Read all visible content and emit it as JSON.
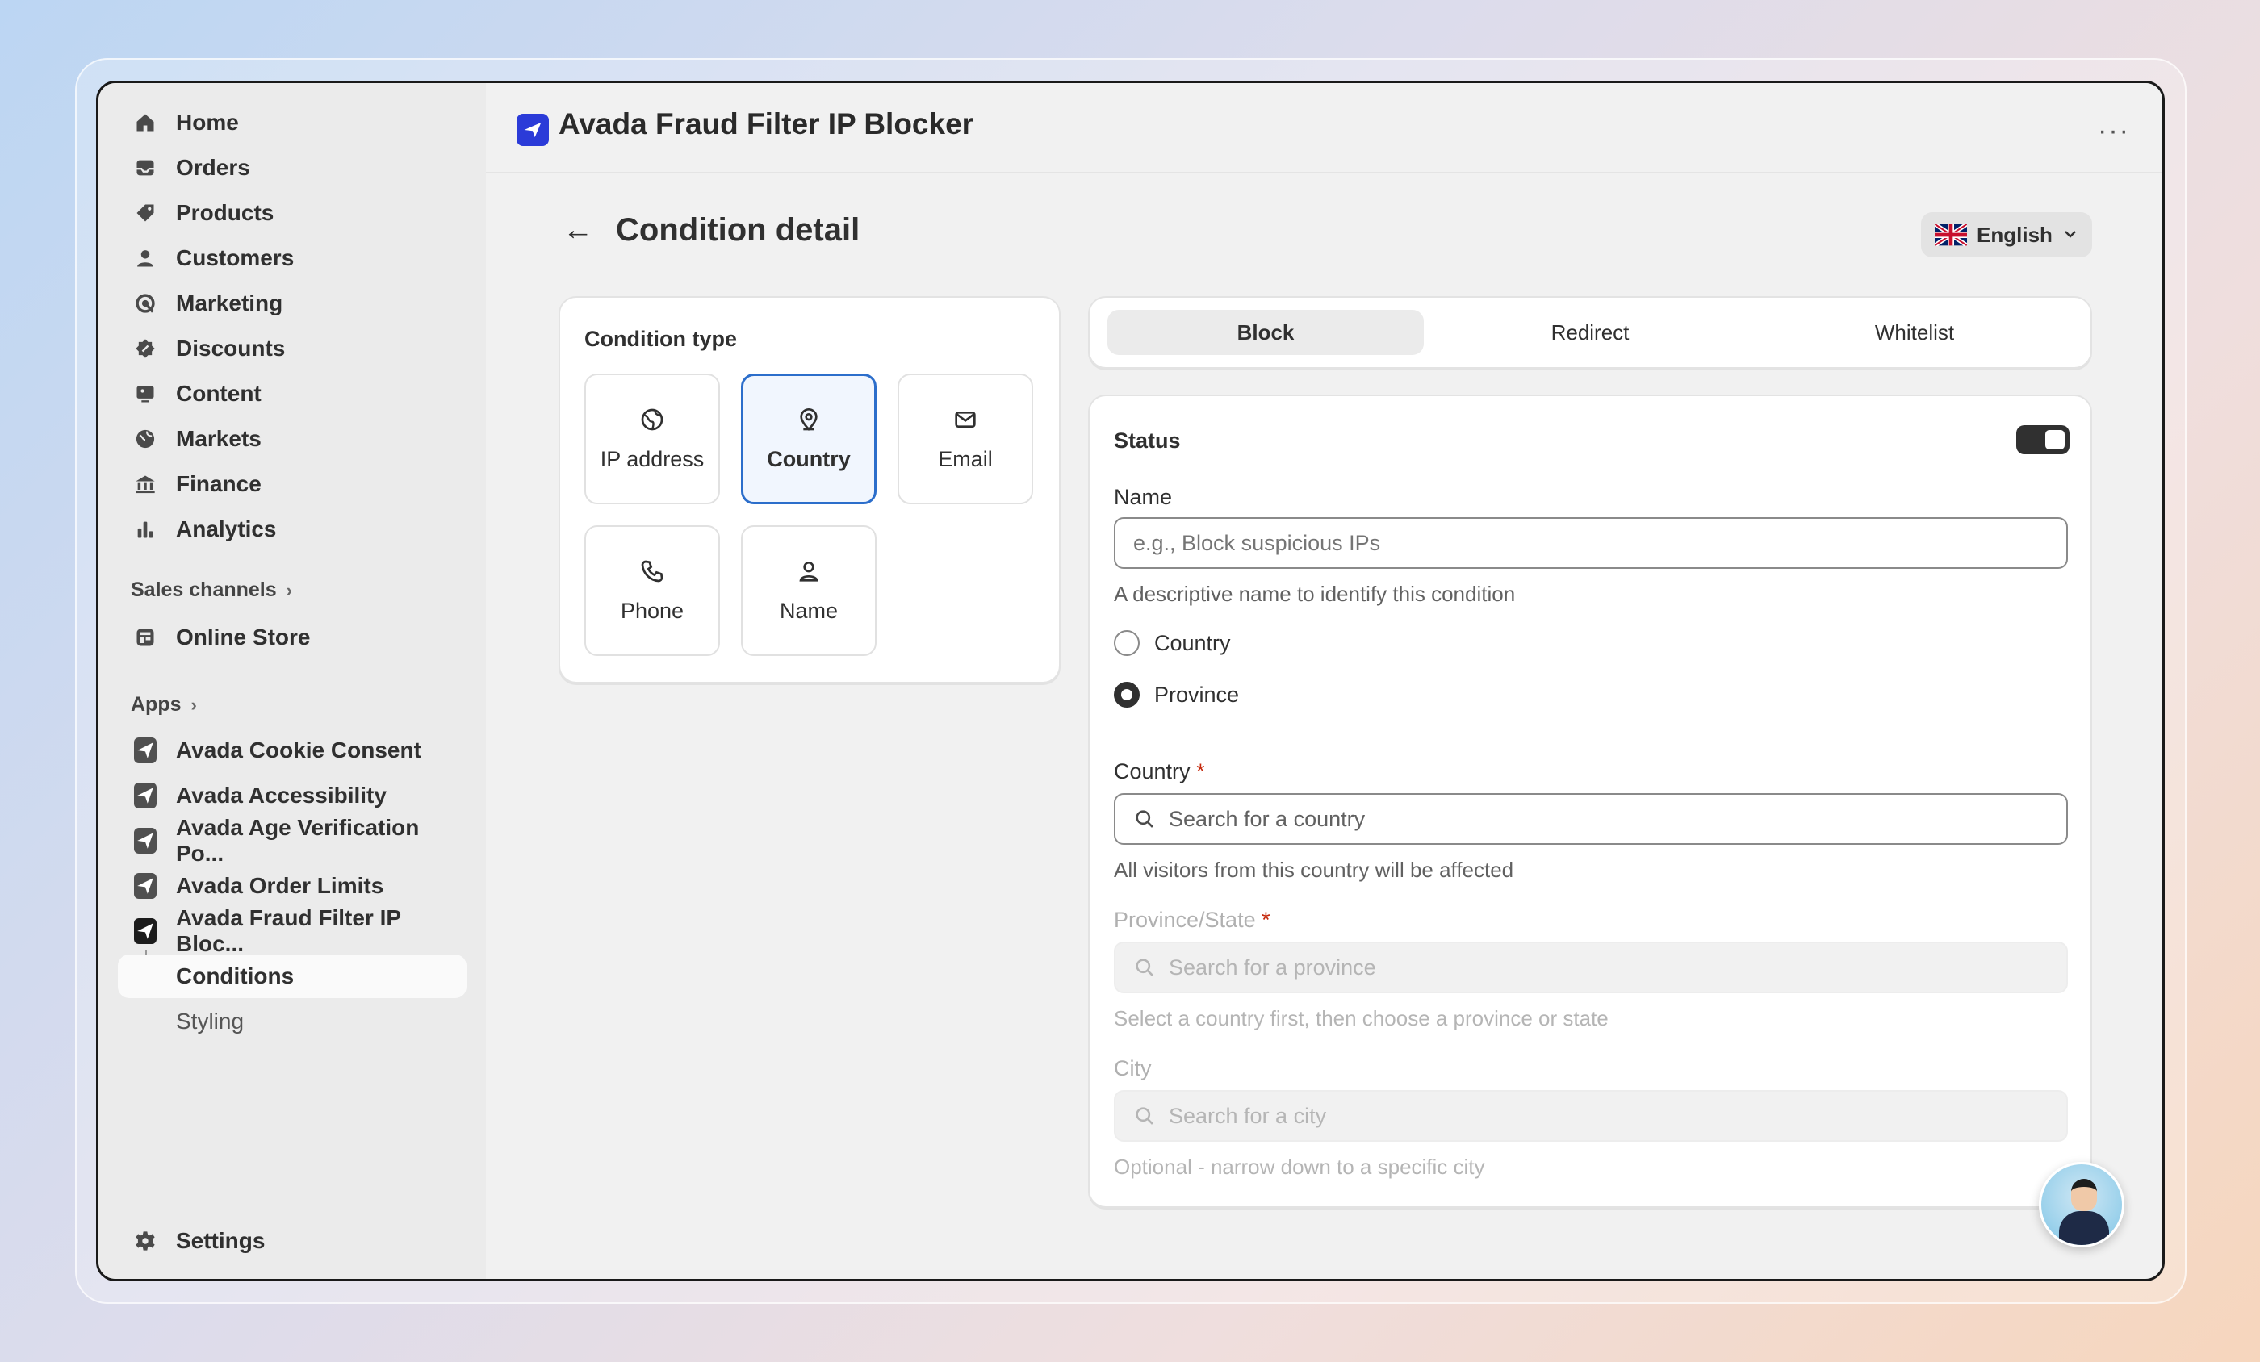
{
  "sidebar": {
    "nav": [
      {
        "label": "Home",
        "icon": "home-icon"
      },
      {
        "label": "Orders",
        "icon": "inbox-icon"
      },
      {
        "label": "Products",
        "icon": "tag-icon"
      },
      {
        "label": "Customers",
        "icon": "person-icon"
      },
      {
        "label": "Marketing",
        "icon": "target-icon"
      },
      {
        "label": "Discounts",
        "icon": "discount-icon"
      },
      {
        "label": "Content",
        "icon": "image-icon"
      },
      {
        "label": "Markets",
        "icon": "globe-icon"
      },
      {
        "label": "Finance",
        "icon": "bank-icon"
      },
      {
        "label": "Analytics",
        "icon": "bar-chart-icon"
      }
    ],
    "sales_channels_label": "Sales channels",
    "online_store_label": "Online Store",
    "apps_label": "Apps",
    "apps": [
      {
        "label": "Avada Cookie Consent"
      },
      {
        "label": "Avada Accessibility"
      },
      {
        "label": "Avada Age Verification Po..."
      },
      {
        "label": "Avada Order Limits"
      },
      {
        "label": "Avada Fraud Filter IP Bloc..."
      }
    ],
    "sub_items": [
      {
        "label": "Conditions"
      },
      {
        "label": "Styling"
      }
    ],
    "settings_label": "Settings"
  },
  "header": {
    "app_title": "Avada Fraud Filter IP Blocker",
    "more_label": "···"
  },
  "page": {
    "back_arrow": "←",
    "title": "Condition detail",
    "language": "English"
  },
  "condition_type": {
    "title": "Condition type",
    "options": [
      {
        "label": "IP address",
        "icon": "globe-icon"
      },
      {
        "label": "Country",
        "icon": "location-pin-icon"
      },
      {
        "label": "Email",
        "icon": "envelope-icon"
      },
      {
        "label": "Phone",
        "icon": "phone-icon"
      },
      {
        "label": "Name",
        "icon": "person-icon"
      }
    ],
    "selected": "Country"
  },
  "tabs": [
    {
      "label": "Block"
    },
    {
      "label": "Redirect"
    },
    {
      "label": "Whitelist"
    }
  ],
  "form": {
    "status_label": "Status",
    "status_on": true,
    "name_label": "Name",
    "name_placeholder": "e.g., Block suspicious IPs",
    "name_help": "A descriptive name to identify this condition",
    "radio_country": "Country",
    "radio_province": "Province",
    "radio_selected": "Province",
    "country_label": "Country",
    "required_mark": "*",
    "country_placeholder": "Search for a country",
    "country_help": "All visitors from this country will be affected",
    "province_label": "Province/State",
    "province_placeholder": "Search for a province",
    "province_help": "Select a country first, then choose a province or state",
    "city_label": "City",
    "city_placeholder": "Search for a city",
    "city_help": "Optional - narrow down to a specific city"
  },
  "colors": {
    "accent_blue": "#2c6ecb",
    "required_red": "#c5280c",
    "app_logo_blue": "#2b3bd8"
  }
}
